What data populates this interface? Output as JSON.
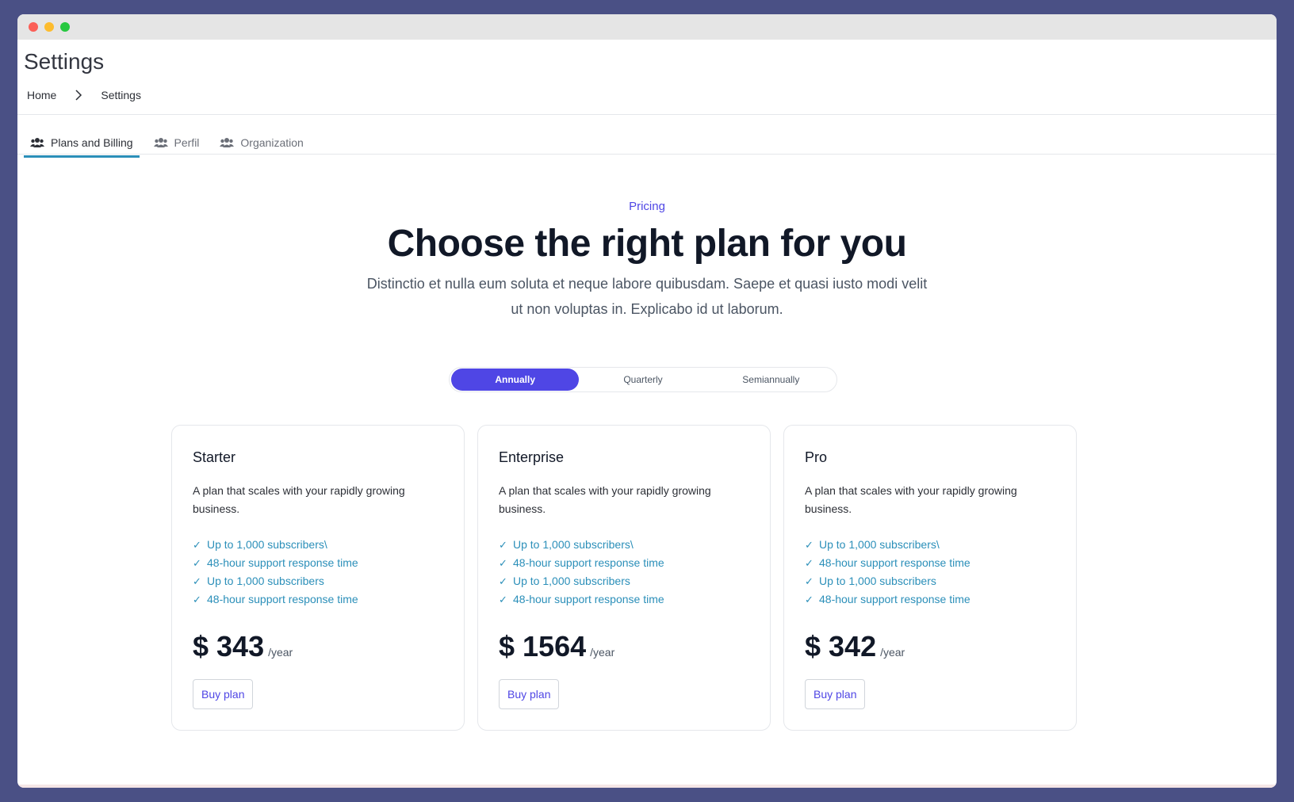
{
  "page": {
    "title": "Settings"
  },
  "breadcrumb": {
    "home": "Home",
    "current": "Settings"
  },
  "tabs": [
    {
      "label": "Plans and Billing",
      "icon": "users-icon",
      "active": true
    },
    {
      "label": "Perfil",
      "icon": "users-icon",
      "active": false
    },
    {
      "label": "Organization",
      "icon": "users-icon",
      "active": false
    }
  ],
  "pricing": {
    "eyebrow": "Pricing",
    "headline": "Choose the right plan for you",
    "subtitle": "Distinctio et nulla eum soluta et neque labore quibusdam. Saepe et quasi iusto modi velit ut non voluptas in. Explicabo id ut laborum."
  },
  "billing_toggle": {
    "options": [
      "Annually",
      "Quarterly",
      "Semiannually"
    ],
    "selected": "Annually"
  },
  "plans": [
    {
      "name": "Starter",
      "description": "A plan that scales with your rapidly growing business.",
      "features": [
        "Up to 1,000 subscribers\\",
        "48-hour support response time",
        "Up to 1,000 subscribers",
        "48-hour support response time"
      ],
      "price": "$ 343",
      "period": "/year",
      "button": "Buy plan"
    },
    {
      "name": "Enterprise",
      "description": "A plan that scales with your rapidly growing business.",
      "features": [
        "Up to 1,000 subscribers\\",
        "48-hour support response time",
        "Up to 1,000 subscribers",
        "48-hour support response time"
      ],
      "price": "$ 1564",
      "period": "/year",
      "button": "Buy plan"
    },
    {
      "name": "Pro",
      "description": "A plan that scales with your rapidly growing business.",
      "features": [
        "Up to 1,000 subscribers\\",
        "48-hour support response time",
        "Up to 1,000 subscribers",
        "48-hour support response time"
      ],
      "price": "$ 342",
      "period": "/year",
      "button": "Buy plan"
    }
  ],
  "colors": {
    "accent": "#4f46e5",
    "feature": "#2b8fb9",
    "background": "#4a5085"
  }
}
